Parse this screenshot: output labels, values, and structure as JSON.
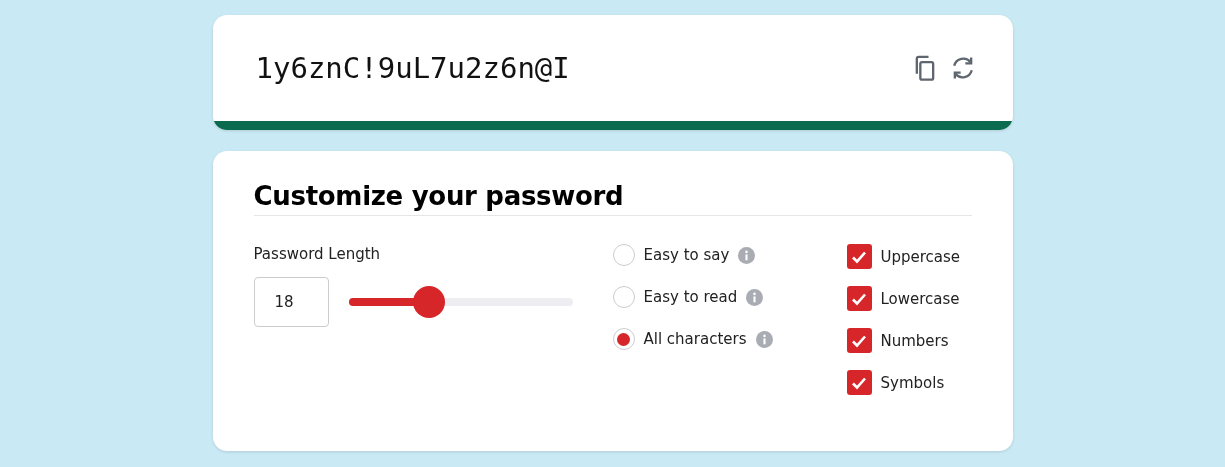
{
  "password": {
    "value": "1y6znC!9uL7u2z6n@I"
  },
  "strength": {
    "level": 1,
    "color": "#0a6b4e"
  },
  "customize": {
    "title": "Customize your password",
    "length_label": "Password Length",
    "length_value": "18",
    "length_slider": {
      "level": 0.36
    },
    "modes": [
      {
        "label": "Easy to say",
        "selected": false
      },
      {
        "label": "Easy to read",
        "selected": false
      },
      {
        "label": "All characters",
        "selected": true
      }
    ],
    "options": [
      {
        "label": "Uppercase",
        "checked": true
      },
      {
        "label": "Lowercase",
        "checked": true
      },
      {
        "label": "Numbers",
        "checked": true
      },
      {
        "label": "Symbols",
        "checked": true
      }
    ]
  }
}
